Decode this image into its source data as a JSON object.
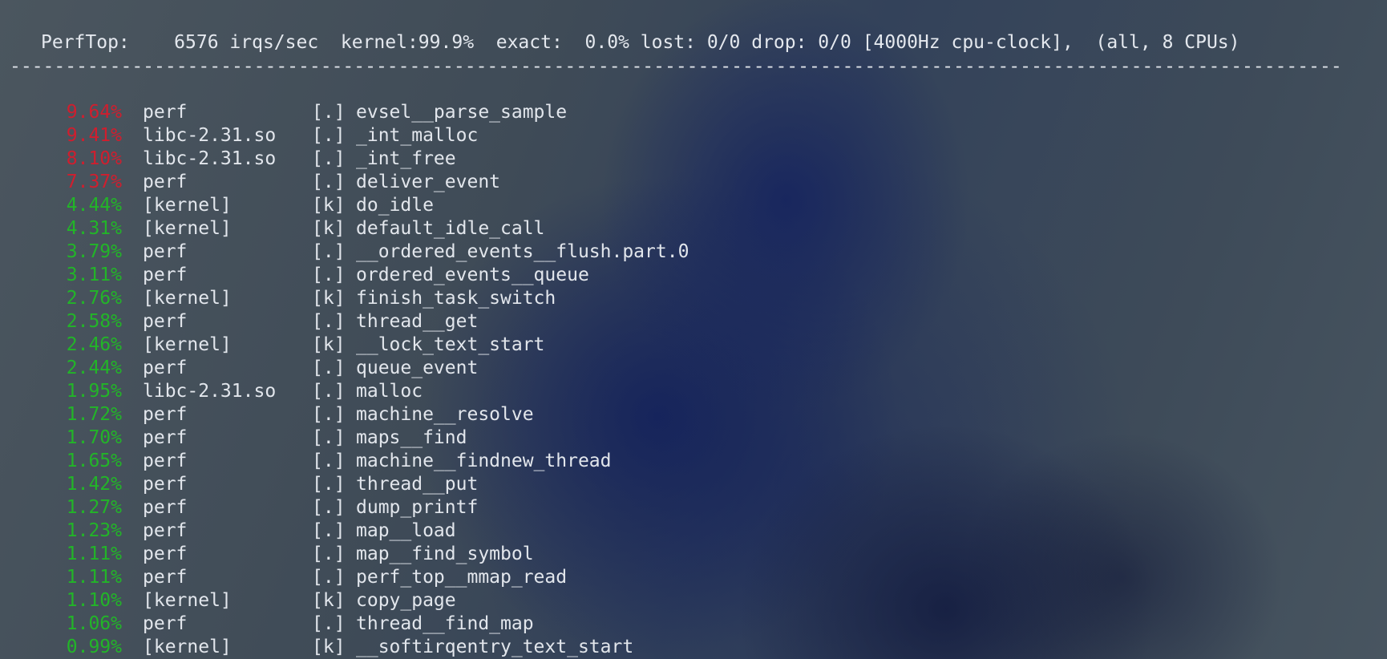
{
  "header": {
    "text": "PerfTop:    6576 irqs/sec  kernel:99.9%  exact:  0.0% lost: 0/0 drop: 0/0 [4000Hz cpu-clock],  (all, 8 CPUs)"
  },
  "divider": "-------------------------------------------------------------------------------------------------------------------------------------------------",
  "colors": {
    "hot": "#d01e2e",
    "normal": "#22b528",
    "text": "#e2e6ec"
  },
  "rows": [
    {
      "pct": "9.64%",
      "dso": "perf",
      "level": "[.]",
      "symbol": "evsel__parse_sample"
    },
    {
      "pct": "9.41%",
      "dso": "libc-2.31.so",
      "level": "[.]",
      "symbol": "_int_malloc"
    },
    {
      "pct": "8.10%",
      "dso": "libc-2.31.so",
      "level": "[.]",
      "symbol": "_int_free"
    },
    {
      "pct": "7.37%",
      "dso": "perf",
      "level": "[.]",
      "symbol": "deliver_event"
    },
    {
      "pct": "4.44%",
      "dso": "[kernel]",
      "level": "[k]",
      "symbol": "do_idle"
    },
    {
      "pct": "4.31%",
      "dso": "[kernel]",
      "level": "[k]",
      "symbol": "default_idle_call"
    },
    {
      "pct": "3.79%",
      "dso": "perf",
      "level": "[.]",
      "symbol": "__ordered_events__flush.part.0"
    },
    {
      "pct": "3.11%",
      "dso": "perf",
      "level": "[.]",
      "symbol": "ordered_events__queue"
    },
    {
      "pct": "2.76%",
      "dso": "[kernel]",
      "level": "[k]",
      "symbol": "finish_task_switch"
    },
    {
      "pct": "2.58%",
      "dso": "perf",
      "level": "[.]",
      "symbol": "thread__get"
    },
    {
      "pct": "2.46%",
      "dso": "[kernel]",
      "level": "[k]",
      "symbol": "__lock_text_start"
    },
    {
      "pct": "2.44%",
      "dso": "perf",
      "level": "[.]",
      "symbol": "queue_event"
    },
    {
      "pct": "1.95%",
      "dso": "libc-2.31.so",
      "level": "[.]",
      "symbol": "malloc"
    },
    {
      "pct": "1.72%",
      "dso": "perf",
      "level": "[.]",
      "symbol": "machine__resolve"
    },
    {
      "pct": "1.70%",
      "dso": "perf",
      "level": "[.]",
      "symbol": "maps__find"
    },
    {
      "pct": "1.65%",
      "dso": "perf",
      "level": "[.]",
      "symbol": "machine__findnew_thread"
    },
    {
      "pct": "1.42%",
      "dso": "perf",
      "level": "[.]",
      "symbol": "thread__put"
    },
    {
      "pct": "1.27%",
      "dso": "perf",
      "level": "[.]",
      "symbol": "dump_printf"
    },
    {
      "pct": "1.23%",
      "dso": "perf",
      "level": "[.]",
      "symbol": "map__load"
    },
    {
      "pct": "1.11%",
      "dso": "perf",
      "level": "[.]",
      "symbol": "map__find_symbol"
    },
    {
      "pct": "1.11%",
      "dso": "perf",
      "level": "[.]",
      "symbol": "perf_top__mmap_read"
    },
    {
      "pct": "1.10%",
      "dso": "[kernel]",
      "level": "[k]",
      "symbol": "copy_page"
    },
    {
      "pct": "1.06%",
      "dso": "perf",
      "level": "[.]",
      "symbol": "thread__find_map"
    },
    {
      "pct": "0.99%",
      "dso": "[kernel]",
      "level": "[k]",
      "symbol": "__softirqentry_text_start"
    }
  ]
}
